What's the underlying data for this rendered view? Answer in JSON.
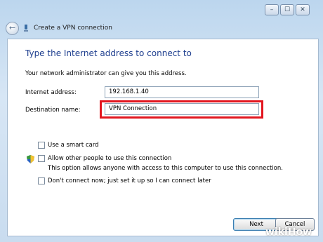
{
  "window": {
    "title": "Create a VPN connection",
    "controls": {
      "minimize": "–",
      "maximize": "☐",
      "close": "✕"
    }
  },
  "page": {
    "heading": "Type the Internet address to connect to",
    "subtitle": "Your network administrator can give you this address."
  },
  "form": {
    "internet_address_label": "Internet address:",
    "internet_address_value": "192.168.1.40",
    "destination_name_label": "Destination name:",
    "destination_name_value": "VPN Connection"
  },
  "options": {
    "smart_card": {
      "label": "Use a smart card",
      "checked": false
    },
    "allow_others": {
      "label": "Allow other people to use this connection",
      "checked": false,
      "note": "This option allows anyone with access to this computer to use this connection."
    },
    "dont_connect": {
      "label": "Don't connect now; just set it up so I can connect later",
      "checked": false
    }
  },
  "buttons": {
    "next": "Next",
    "cancel": "Cancel"
  },
  "watermark": {
    "wiki": "wiki",
    "how": "How"
  },
  "colors": {
    "heading": "#1f3f8f",
    "highlight": "#e2161f"
  }
}
